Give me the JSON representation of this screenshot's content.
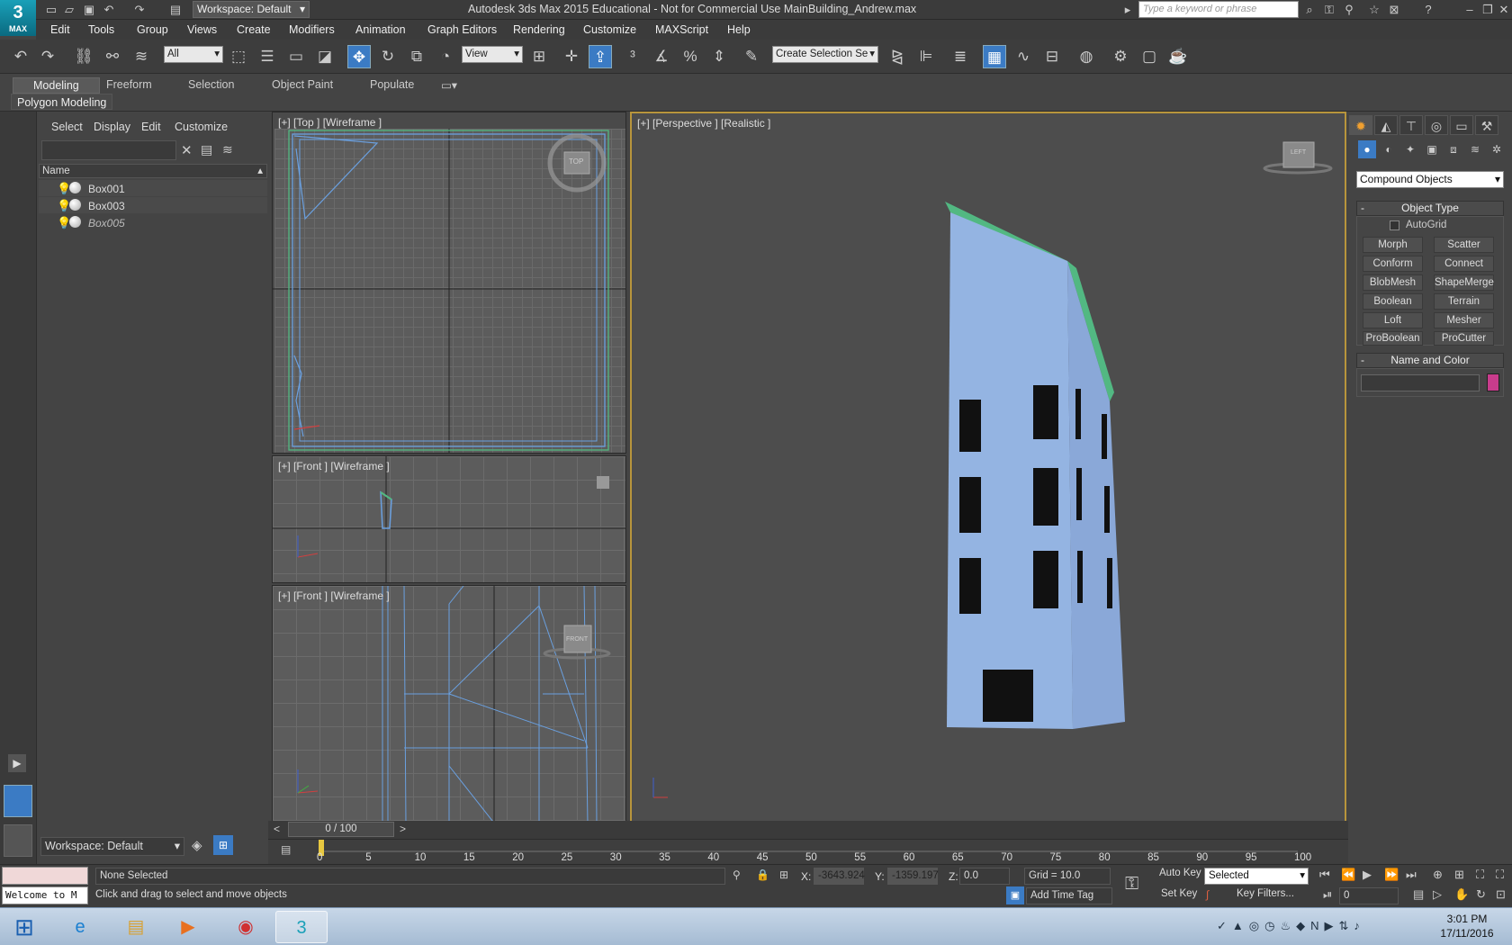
{
  "app": {
    "logo_text": "MAX",
    "window_title": "Autodesk 3ds Max  2015   Educational  - Not for Commercial Use    MainBuilding_Andrew.max",
    "workspace": "Workspace: Default",
    "search_placeholder": "Type a keyword or phrase"
  },
  "menu": [
    "Edit",
    "Tools",
    "Group",
    "Views",
    "Create",
    "Modifiers",
    "Animation",
    "Graph Editors",
    "Rendering",
    "Customize",
    "MAXScript",
    "Help"
  ],
  "toolbar": {
    "selection_filter": "All",
    "ref_coord": "View",
    "named_selection": "Create Selection Se"
  },
  "ribbon": {
    "tabs": [
      "Modeling",
      "Freeform",
      "Selection",
      "Object Paint",
      "Populate"
    ],
    "active_tab": "Modeling",
    "panel": "Polygon Modeling"
  },
  "explorer": {
    "menus": [
      "Select",
      "Display",
      "Edit",
      "Customize"
    ],
    "column_header": "Name",
    "objects": [
      {
        "name": "Box001",
        "frozen": false
      },
      {
        "name": "Box003",
        "frozen": false
      },
      {
        "name": "Box005",
        "frozen": true
      }
    ],
    "workspace": "Workspace: Default"
  },
  "viewports": {
    "top": {
      "label": "[+] [Top ] [Wireframe ]",
      "cube": "TOP"
    },
    "front1": {
      "label": "[+] [Front ] [Wireframe ]"
    },
    "front2": {
      "label": "[+] [Front ] [Wireframe ]",
      "cube": "FRONT"
    },
    "perspective": {
      "label": "[+] [Perspective ] [Realistic ]",
      "cube": "LEFT"
    }
  },
  "command_panel": {
    "category": "Compound Objects",
    "object_type_title": "Object Type",
    "autogrid": "AutoGrid",
    "buttons": [
      "Morph",
      "Scatter",
      "Conform",
      "Connect",
      "BlobMesh",
      "ShapeMerge",
      "Boolean",
      "Terrain",
      "Loft",
      "Mesher",
      "ProBoolean",
      "ProCutter"
    ],
    "name_color_title": "Name and Color",
    "object_color": "#c83c8c"
  },
  "timeline": {
    "frame": "0 / 100",
    "ticks": [
      "0",
      "5",
      "10",
      "15",
      "20",
      "25",
      "30",
      "35",
      "40",
      "45",
      "50",
      "55",
      "60",
      "65",
      "70",
      "75",
      "80",
      "85",
      "90",
      "95",
      "100"
    ]
  },
  "status": {
    "maxscript": "Welcome to M",
    "selection": "None Selected",
    "prompt": "Click and drag to select and move objects",
    "x_label": "X:",
    "x": "-3643.924",
    "y_label": "Y:",
    "y": "-1359.197",
    "z_label": "Z:",
    "z": "0.0",
    "grid": "Grid = 10.0",
    "add_time_tag": "Add Time Tag",
    "auto_key": "Auto Key",
    "set_key": "Set Key",
    "key_mode": "Selected",
    "key_filters": "Key Filters...",
    "frame_field": "0"
  },
  "taskbar": {
    "time": "3:01 PM",
    "date": "17/11/2016"
  },
  "colors": {
    "building": "#94b4e2",
    "roof": "#52b882",
    "viewport_active_border": "#b8953c"
  }
}
